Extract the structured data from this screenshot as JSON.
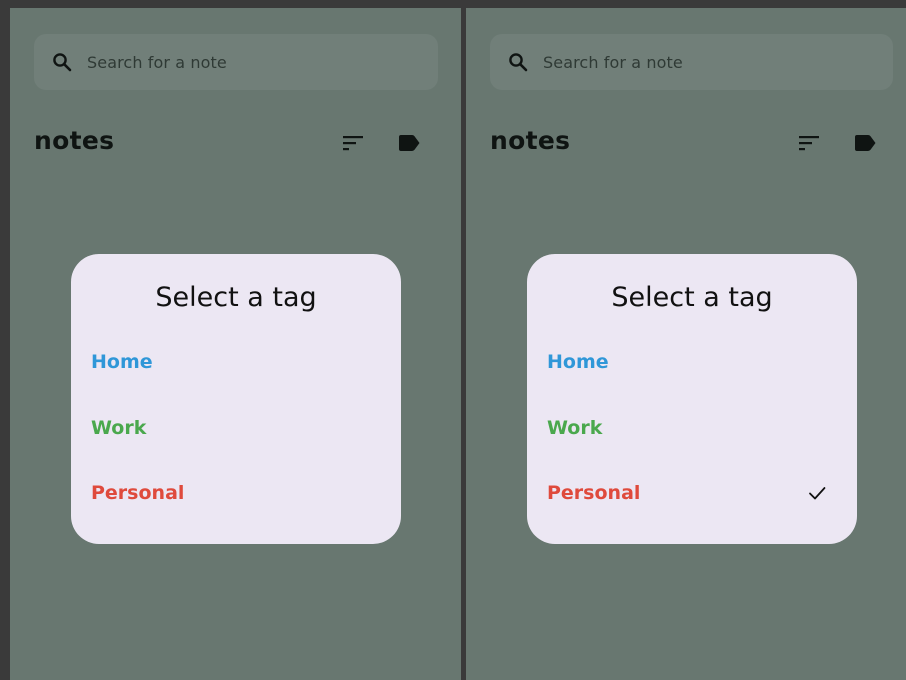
{
  "screens": [
    {
      "search": {
        "placeholder": "Search for a note"
      },
      "header": {
        "title": "notes"
      },
      "dialog": {
        "title": "Select a tag",
        "options": [
          {
            "label": "Home",
            "color": "#2f97d8",
            "selected": false
          },
          {
            "label": "Work",
            "color": "#4aa84d",
            "selected": false
          },
          {
            "label": "Personal",
            "color": "#df4a3c",
            "selected": false
          }
        ]
      }
    },
    {
      "search": {
        "placeholder": "Search for a note"
      },
      "header": {
        "title": "notes"
      },
      "dialog": {
        "title": "Select a tag",
        "options": [
          {
            "label": "Home",
            "color": "#2f97d8",
            "selected": false
          },
          {
            "label": "Work",
            "color": "#4aa84d",
            "selected": false
          },
          {
            "label": "Personal",
            "color": "#df4a3c",
            "selected": true
          }
        ]
      }
    }
  ],
  "icons": {
    "search": "search-icon",
    "sort": "sort-icon",
    "tag": "label-icon",
    "check": "check-icon"
  },
  "colors": {
    "scrim": "#687770",
    "search_bg": "#717f79",
    "dialog_bg": "#ece7f3",
    "divider": "#3a3a3a"
  }
}
